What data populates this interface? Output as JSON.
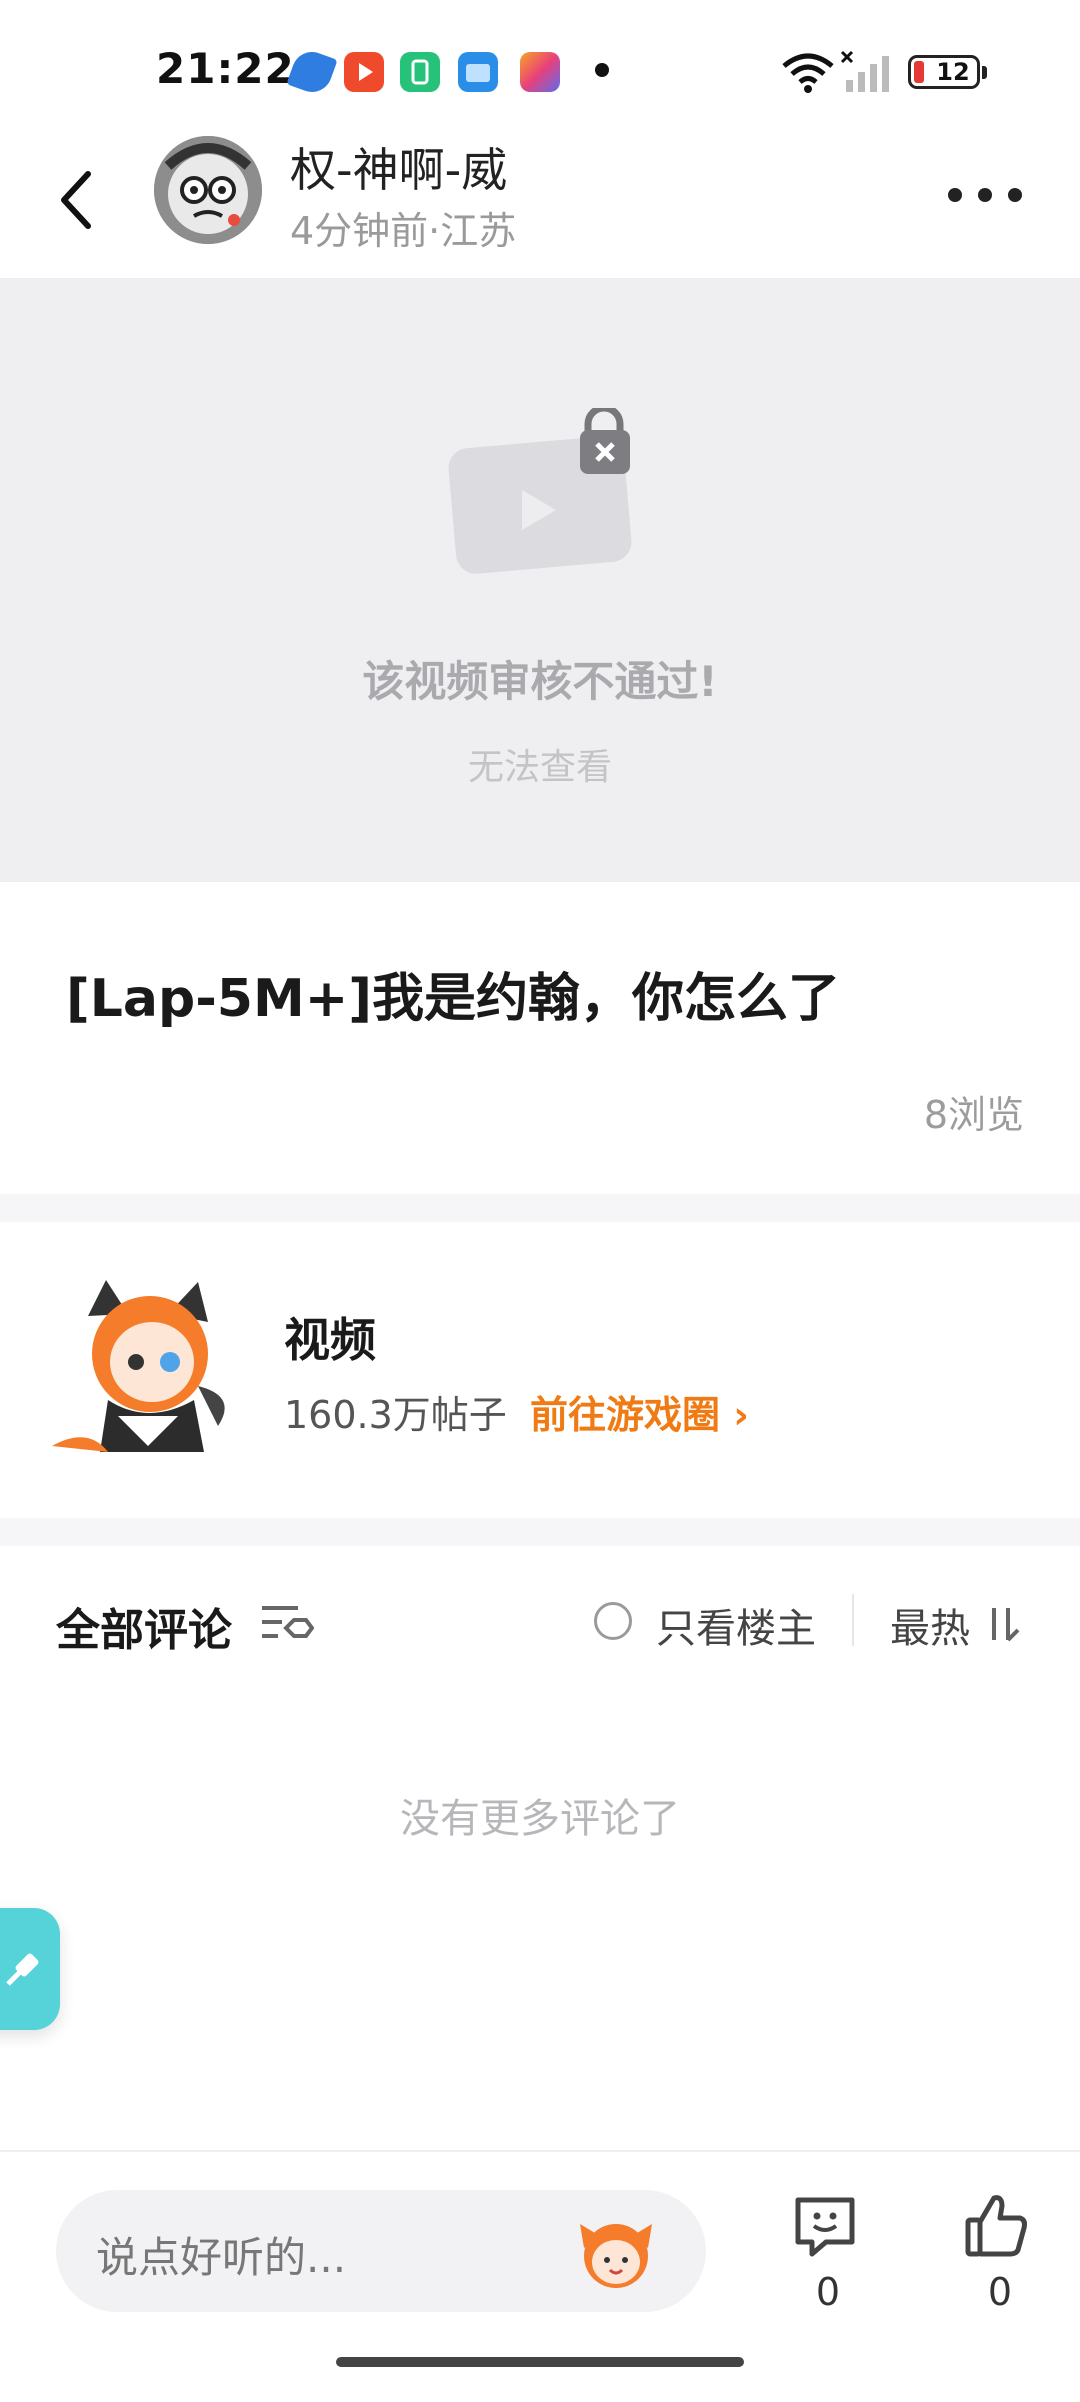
{
  "status_bar": {
    "time": "21:22",
    "battery": "12",
    "app_icons": [
      "blue-app-icon",
      "video-app-icon",
      "green-app-icon",
      "wallet-app-icon",
      "shortcut-app-icon"
    ]
  },
  "header": {
    "username": "权-神啊-威",
    "meta": "4分钟前·江苏"
  },
  "video": {
    "blocked_title": "该视频审核不通过!",
    "blocked_subtitle": "无法查看"
  },
  "post": {
    "title": "[Lap-5M+]我是约翰，你怎么了",
    "views": "8浏览"
  },
  "circle": {
    "name": "视频",
    "posts": "160.3万帖子",
    "link": "前往游戏圈 ›"
  },
  "comments": {
    "title": "全部评论",
    "only_op": "只看楼主",
    "sort": "最热",
    "empty": "没有更多评论了"
  },
  "bottom": {
    "placeholder": "说点好听的...",
    "comment_count": "0",
    "like_count": "0"
  },
  "colors": {
    "accent": "#f07a14",
    "float_button": "#55d3d9",
    "battery_low": "#e53935"
  }
}
